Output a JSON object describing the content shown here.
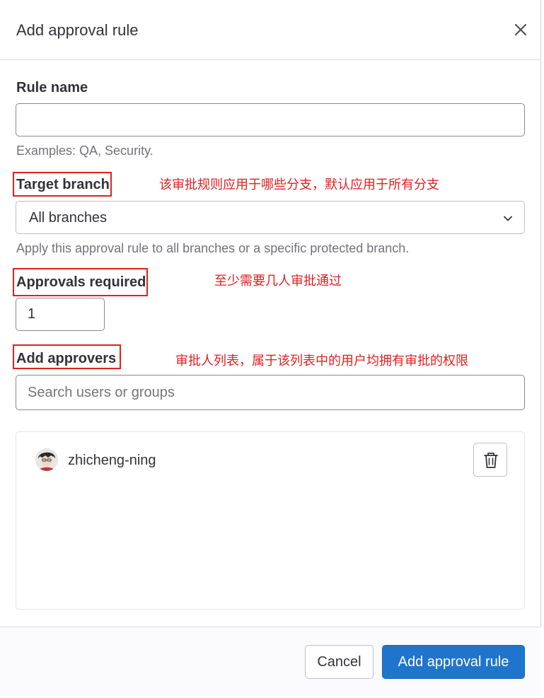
{
  "modal": {
    "title": "Add approval rule",
    "close_icon": "close-icon"
  },
  "rule_name": {
    "label": "Rule name",
    "value": "",
    "placeholder": "",
    "help": "Examples: QA, Security."
  },
  "target_branch": {
    "label": "Target branch",
    "selected": "All branches",
    "help": "Apply this approval rule to all branches or a specific protected branch.",
    "annotation": "该审批规则应用于哪些分支，默认应用于所有分支"
  },
  "approvals_required": {
    "label": "Approvals required",
    "value": "1",
    "annotation": "至少需要几人审批通过"
  },
  "add_approvers": {
    "label": "Add approvers",
    "placeholder": "Search users or groups",
    "annotation": "审批人列表，属于该列表中的用户均拥有审批的权限"
  },
  "approvers": [
    {
      "name": "zhicheng-ning",
      "avatar_icon": "user-avatar",
      "delete_icon": "trash-icon"
    }
  ],
  "footer": {
    "cancel_label": "Cancel",
    "submit_label": "Add approval rule"
  },
  "colors": {
    "annotation": "#e02020",
    "primary": "#1f75cb",
    "text": "#333238",
    "muted": "#737278"
  }
}
